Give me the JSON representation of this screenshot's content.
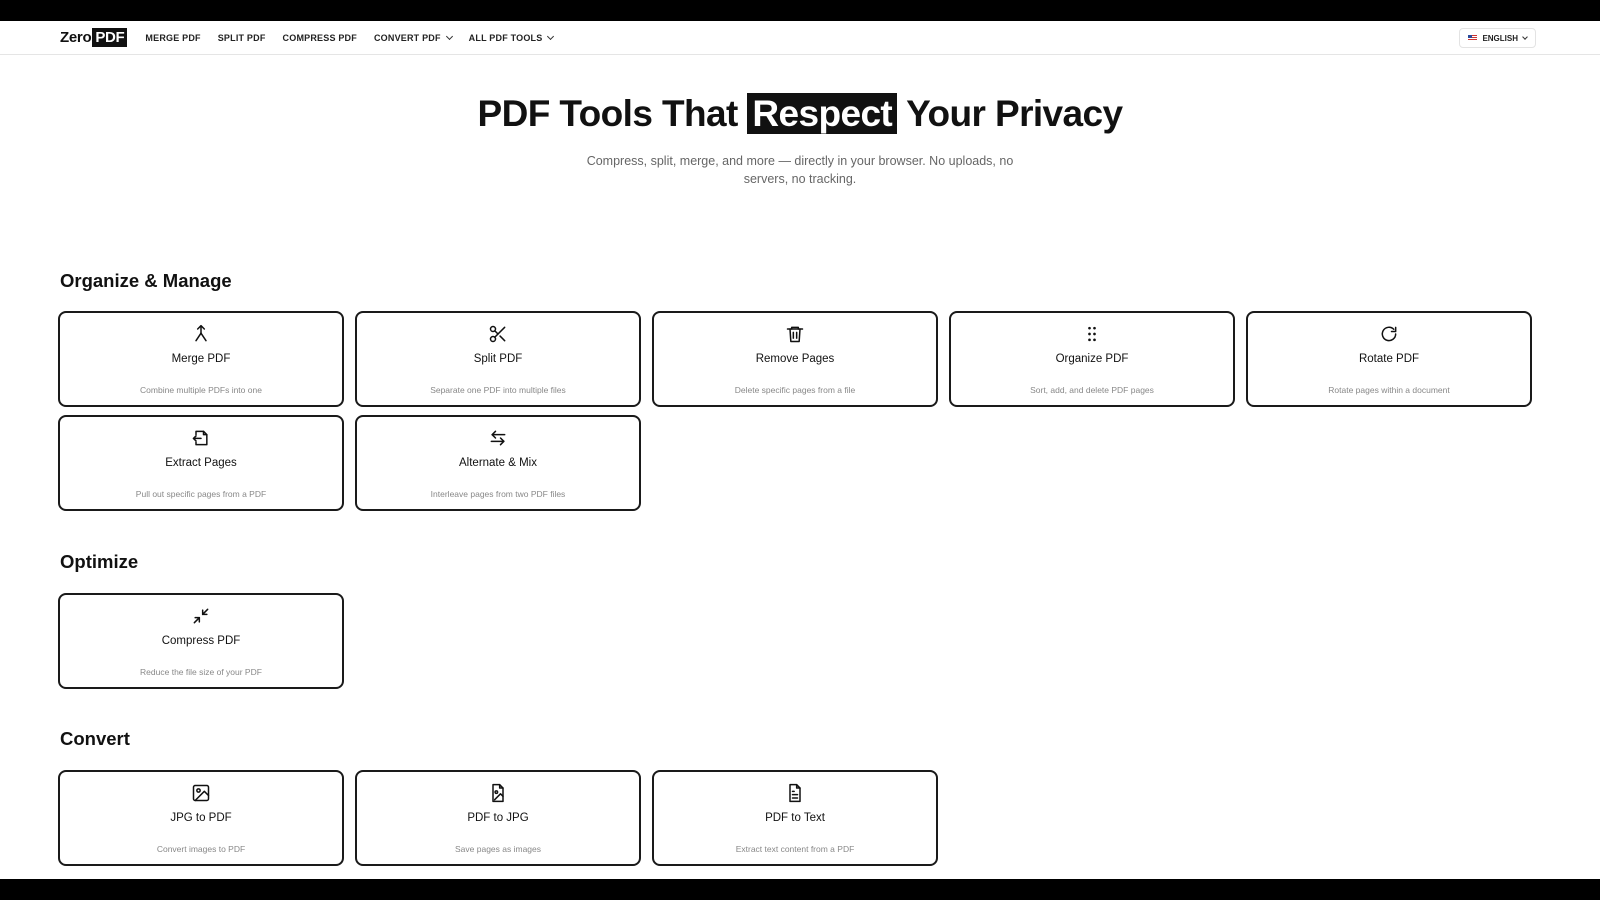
{
  "nav": {
    "logo_zero": "Zero",
    "logo_pdf": "PDF",
    "links": [
      "MERGE PDF",
      "SPLIT PDF",
      "COMPRESS PDF",
      "CONVERT PDF",
      "ALL PDF TOOLS"
    ],
    "language": "ENGLISH"
  },
  "hero": {
    "title_before": "PDF Tools That",
    "title_highlight": "Respect",
    "title_after": "Your Privacy",
    "subtitle": "Compress, split, merge, and more — directly in your browser. No uploads, no servers, no tracking."
  },
  "sections": {
    "organize": {
      "title": "Organize & Manage",
      "cards": [
        {
          "title": "Merge PDF",
          "desc": "Combine multiple PDFs into one",
          "icon": "merge-icon"
        },
        {
          "title": "Split PDF",
          "desc": "Separate one PDF into multiple files",
          "icon": "scissors-icon"
        },
        {
          "title": "Remove Pages",
          "desc": "Delete specific pages from a file",
          "icon": "trash-icon"
        },
        {
          "title": "Organize PDF",
          "desc": "Sort, add, and delete PDF pages",
          "icon": "grip-icon"
        },
        {
          "title": "Rotate PDF",
          "desc": "Rotate pages within a document",
          "icon": "rotate-icon"
        },
        {
          "title": "Extract Pages",
          "desc": "Pull out specific pages from a PDF",
          "icon": "extract-icon"
        },
        {
          "title": "Alternate & Mix",
          "desc": "Interleave pages from two PDF files",
          "icon": "swap-icon"
        }
      ]
    },
    "optimize": {
      "title": "Optimize",
      "cards": [
        {
          "title": "Compress PDF",
          "desc": "Reduce the file size of your PDF",
          "icon": "compress-icon"
        }
      ]
    },
    "convert": {
      "title": "Convert",
      "cards": [
        {
          "title": "JPG to PDF",
          "desc": "Convert images to PDF",
          "icon": "image-icon"
        },
        {
          "title": "PDF to JPG",
          "desc": "Save pages as images",
          "icon": "file-image-icon"
        },
        {
          "title": "PDF to Text",
          "desc": "Extract text content from a PDF",
          "icon": "file-text-icon"
        }
      ]
    }
  }
}
